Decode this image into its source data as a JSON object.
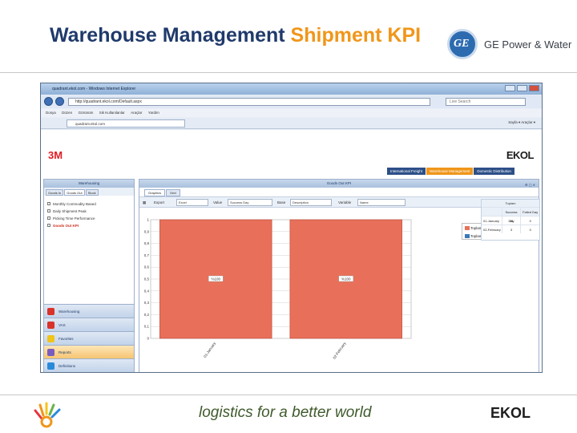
{
  "slide": {
    "title_part1": "Warehouse Management",
    "title_part2": "Shipment KPI",
    "partner_name": "GE Power & Water",
    "slogan": "logistics for a better world",
    "footer_logo": "EKOL"
  },
  "browser": {
    "window_title": "quadrant.ekol.com - Windows Internet Explorer",
    "address": "http://quadrant.ekol.com/Default.aspx",
    "search_placeholder": "Live Search",
    "menu": [
      "Dosya",
      "Düzen",
      "Görünüm",
      "Sik Kullanilanlar",
      "Araçlar",
      "Yardim"
    ],
    "favorites_tab": "quadrant.ekol.com",
    "tools": "Sayfa ▾  Araçlar ▾"
  },
  "app": {
    "brand_left": "3M",
    "brand_right": "EKOL",
    "top_tabs": [
      "International Freight",
      "Warehouse Management",
      "Domestic Distribution"
    ],
    "active_top_tab": 1,
    "sidebar": {
      "title": "Warehousing",
      "tabs": [
        "Goods In",
        "Goods Out",
        "Stock"
      ],
      "items": [
        "Monthly Commodity Based",
        "Daily Shipment Peak",
        "Picking Time Performance",
        "Goods Out KPI"
      ],
      "selected_item": 3,
      "nav": [
        {
          "label": "Warehousing",
          "icon": "warehouse-icon",
          "color": "#d9322a"
        },
        {
          "label": "VAS",
          "icon": "vas-icon",
          "color": "#d9322a"
        },
        {
          "label": "Favorites",
          "icon": "star-icon",
          "color": "#f0c419"
        },
        {
          "label": "Reports",
          "icon": "chart-icon",
          "color": "#7a5cc0"
        },
        {
          "label": "Definitions",
          "icon": "settings-icon",
          "color": "#2a8ad9"
        }
      ],
      "active_nav": 3
    },
    "main": {
      "title": "Goods Out KPI",
      "view_tabs": [
        "Graphics",
        "Grid"
      ],
      "toolbar": {
        "export_label": "Export",
        "export_value": "Excel",
        "value_label": "Value",
        "value_value": "Success Day",
        "base_label": "Base",
        "base_value": "Description",
        "variable_label": "Variable",
        "variable_value": "Name"
      },
      "grid": {
        "title": "Toplam",
        "columns": [
          "",
          "Success Day",
          "Failed Day"
        ],
        "rows": [
          [
            "01-January",
            "30",
            "0"
          ],
          [
            "02-February",
            "3",
            "0"
          ]
        ]
      }
    }
  },
  "chart_data": {
    "type": "bar",
    "categories": [
      "01-January",
      "02-February"
    ],
    "series": [
      {
        "name": "Toplam | Success Day",
        "values": [
          1,
          1
        ],
        "labels": [
          "%100",
          "%100"
        ],
        "color": "#e8705a"
      },
      {
        "name": "Toplam | Failed Day",
        "values": [
          0,
          0
        ],
        "color": "#3a78b8"
      }
    ],
    "yticks": [
      "0",
      "0,1",
      "0,2",
      "0,3",
      "0,4",
      "0,5",
      "0,6",
      "0,7",
      "0,8",
      "0,9",
      "1"
    ],
    "ylim": [
      0,
      1
    ],
    "grid": true,
    "legend": "top-right"
  }
}
